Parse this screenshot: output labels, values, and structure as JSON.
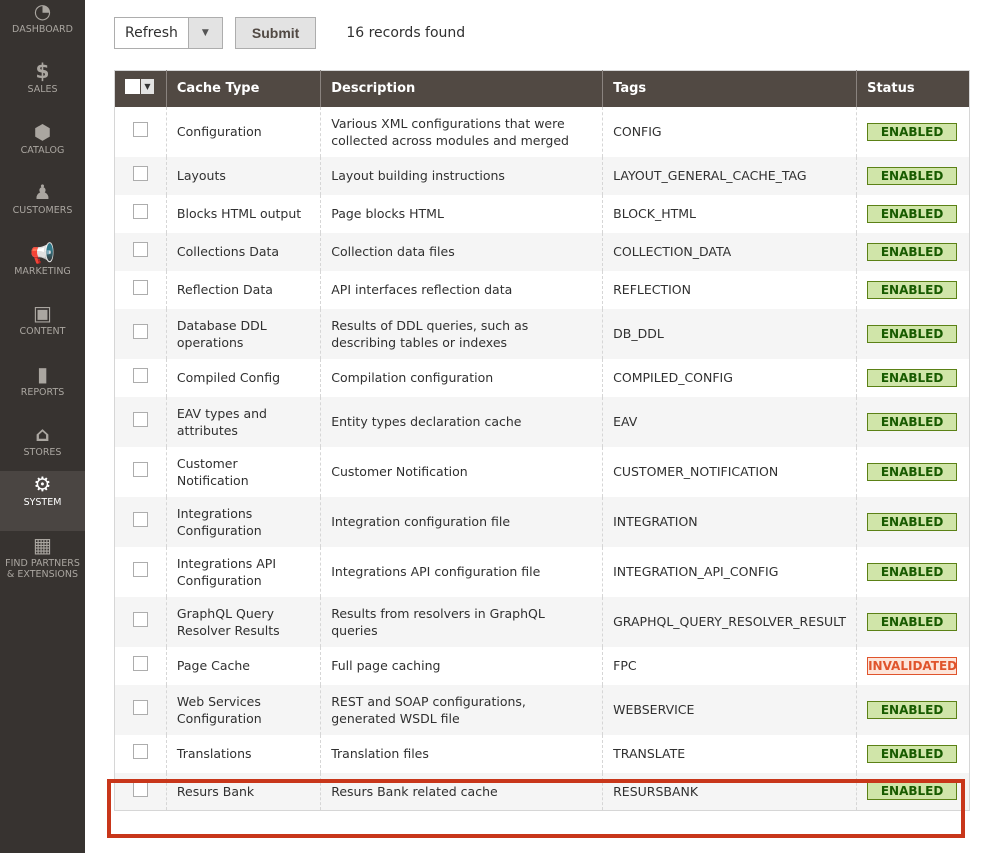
{
  "sidebar": {
    "items": [
      {
        "label": "DASHBOARD",
        "icon": "dashboard-icon",
        "glyph": "◔"
      },
      {
        "label": "SALES",
        "icon": "dollar-icon",
        "glyph": "$"
      },
      {
        "label": "CATALOG",
        "icon": "box-icon",
        "glyph": "⬢"
      },
      {
        "label": "CUSTOMERS",
        "icon": "person-icon",
        "glyph": "♟"
      },
      {
        "label": "MARKETING",
        "icon": "megaphone-icon",
        "glyph": "📢"
      },
      {
        "label": "CONTENT",
        "icon": "layout-icon",
        "glyph": "▣"
      },
      {
        "label": "REPORTS",
        "icon": "bar-chart-icon",
        "glyph": "▮"
      },
      {
        "label": "STORES",
        "icon": "store-icon",
        "glyph": "⌂"
      },
      {
        "label": "SYSTEM",
        "icon": "gear-icon",
        "glyph": "⚙",
        "active": true
      },
      {
        "label": "FIND PARTNERS & EXTENSIONS",
        "icon": "lego-block-icon",
        "glyph": "▦"
      }
    ]
  },
  "toolbar": {
    "action": "Refresh",
    "submit": "Submit",
    "records": "16 records found"
  },
  "table": {
    "headers": [
      "Cache Type",
      "Description",
      "Tags",
      "Status"
    ],
    "rows": [
      {
        "type": "Configuration",
        "desc": "Various XML configurations that were collected across modules and merged",
        "tags": "CONFIG",
        "status": "ENABLED"
      },
      {
        "type": "Layouts",
        "desc": "Layout building instructions",
        "tags": "LAYOUT_GENERAL_CACHE_TAG",
        "status": "ENABLED"
      },
      {
        "type": "Blocks HTML output",
        "desc": "Page blocks HTML",
        "tags": "BLOCK_HTML",
        "status": "ENABLED"
      },
      {
        "type": "Collections Data",
        "desc": "Collection data files",
        "tags": "COLLECTION_DATA",
        "status": "ENABLED"
      },
      {
        "type": "Reflection Data",
        "desc": "API interfaces reflection data",
        "tags": "REFLECTION",
        "status": "ENABLED"
      },
      {
        "type": "Database DDL operations",
        "desc": "Results of DDL queries, such as describing tables or indexes",
        "tags": "DB_DDL",
        "status": "ENABLED"
      },
      {
        "type": "Compiled Config",
        "desc": "Compilation configuration",
        "tags": "COMPILED_CONFIG",
        "status": "ENABLED"
      },
      {
        "type": "EAV types and attributes",
        "desc": "Entity types declaration cache",
        "tags": "EAV",
        "status": "ENABLED"
      },
      {
        "type": "Customer Notification",
        "desc": "Customer Notification",
        "tags": "CUSTOMER_NOTIFICATION",
        "status": "ENABLED"
      },
      {
        "type": "Integrations Configuration",
        "desc": "Integration configuration file",
        "tags": "INTEGRATION",
        "status": "ENABLED"
      },
      {
        "type": "Integrations API Configuration",
        "desc": "Integrations API configuration file",
        "tags": "INTEGRATION_API_CONFIG",
        "status": "ENABLED"
      },
      {
        "type": "GraphQL Query Resolver Results",
        "desc": "Results from resolvers in GraphQL queries",
        "tags": "GRAPHQL_QUERY_RESOLVER_RESULT",
        "status": "ENABLED"
      },
      {
        "type": "Page Cache",
        "desc": "Full page caching",
        "tags": "FPC",
        "status": "INVALIDATED"
      },
      {
        "type": "Web Services Configuration",
        "desc": "REST and SOAP configurations, generated WSDL file",
        "tags": "WEBSERVICE",
        "status": "ENABLED"
      },
      {
        "type": "Translations",
        "desc": "Translation files",
        "tags": "TRANSLATE",
        "status": "ENABLED"
      },
      {
        "type": "Resurs Bank",
        "desc": "Resurs Bank related cache",
        "tags": "RESURSBANK",
        "status": "ENABLED"
      }
    ]
  },
  "colors": {
    "sidebar": "#373330",
    "header": "#514943",
    "enabled": "#d0e5a9",
    "invalidated": "#e0542c",
    "highlight": "#c8361a"
  }
}
